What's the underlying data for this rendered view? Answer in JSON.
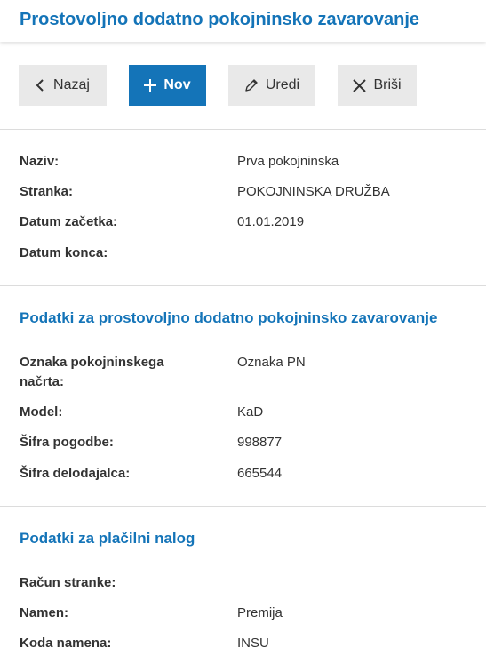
{
  "header": {
    "title": "Prostovoljno dodatno pokojninsko zavarovanje"
  },
  "toolbar": {
    "back_label": "Nazaj",
    "new_label": "Nov",
    "edit_label": "Uredi",
    "delete_label": "Briši"
  },
  "colors": {
    "accent": "#1474b8",
    "button_bg": "#e9e9e9"
  },
  "icons": {
    "back": "chevron-left-icon",
    "new": "plus-icon",
    "edit": "pencil-icon",
    "delete": "close-icon"
  },
  "general": {
    "rows": [
      {
        "label": "Naziv:",
        "value": "Prva pokojninska"
      },
      {
        "label": "Stranka:",
        "value": "POKOJNINSKA DRUŽBA"
      },
      {
        "label": "Datum začetka:",
        "value": "01.01.2019"
      },
      {
        "label": "Datum konca:",
        "value": ""
      }
    ]
  },
  "pension": {
    "title": "Podatki za prostovoljno dodatno pokojninsko zavarovanje",
    "rows": [
      {
        "label": "Oznaka pokojninskega načrta:",
        "value": "Oznaka PN"
      },
      {
        "label": "Model:",
        "value": "KaD"
      },
      {
        "label": "Šifra pogodbe:",
        "value": "998877"
      },
      {
        "label": "Šifra delodajalca:",
        "value": "665544"
      }
    ]
  },
  "payment": {
    "title": "Podatki za plačilni nalog",
    "rows": [
      {
        "label": "Račun stranke:",
        "value": ""
      },
      {
        "label": "Namen:",
        "value": "Premija"
      },
      {
        "label": "Koda namena:",
        "value": "INSU"
      }
    ]
  }
}
